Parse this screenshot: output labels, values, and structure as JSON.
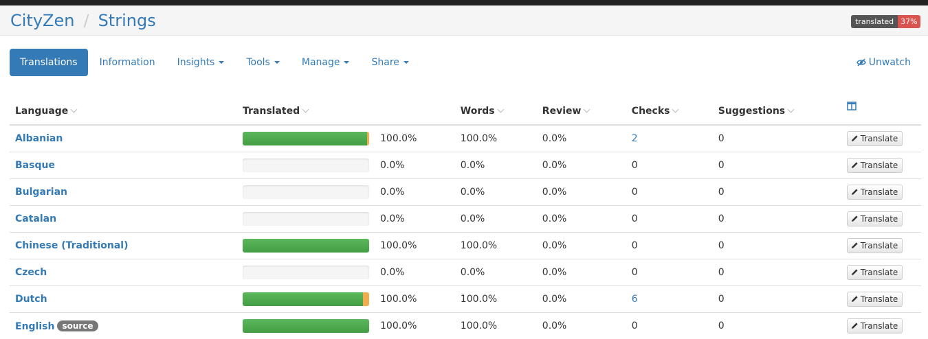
{
  "header": {
    "project": "CityZen",
    "separator": "/",
    "component": "Strings",
    "badge_label": "translated",
    "badge_value": "37%",
    "badge_color": "#d9534f"
  },
  "nav": {
    "tabs": [
      {
        "label": "Translations",
        "active": true,
        "dropdown": false
      },
      {
        "label": "Information",
        "active": false,
        "dropdown": false
      },
      {
        "label": "Insights",
        "active": false,
        "dropdown": true
      },
      {
        "label": "Tools",
        "active": false,
        "dropdown": true
      },
      {
        "label": "Manage",
        "active": false,
        "dropdown": true
      },
      {
        "label": "Share",
        "active": false,
        "dropdown": true
      }
    ],
    "unwatch_label": "Unwatch",
    "unwatch_icon": "eye-slash-icon"
  },
  "table": {
    "columns": {
      "language": "Language",
      "translated": "Translated",
      "words": "Words",
      "review": "Review",
      "checks": "Checks",
      "suggestions": "Suggestions"
    },
    "translate_label": "Translate",
    "columns_icon": "columns-icon",
    "rows": [
      {
        "language": "Albanian",
        "badge": "",
        "progress_ok": 0.985,
        "progress_warn": 0.015,
        "translated": "100.0%",
        "words": "100.0%",
        "review": "0.0%",
        "checks": "2",
        "checks_link": true,
        "suggestions": "0"
      },
      {
        "language": "Basque",
        "badge": "",
        "progress_ok": 0,
        "progress_warn": 0,
        "translated": "0.0%",
        "words": "0.0%",
        "review": "0.0%",
        "checks": "0",
        "checks_link": false,
        "suggestions": "0"
      },
      {
        "language": "Bulgarian",
        "badge": "",
        "progress_ok": 0,
        "progress_warn": 0,
        "translated": "0.0%",
        "words": "0.0%",
        "review": "0.0%",
        "checks": "0",
        "checks_link": false,
        "suggestions": "0"
      },
      {
        "language": "Catalan",
        "badge": "",
        "progress_ok": 0,
        "progress_warn": 0,
        "translated": "0.0%",
        "words": "0.0%",
        "review": "0.0%",
        "checks": "0",
        "checks_link": false,
        "suggestions": "0"
      },
      {
        "language": "Chinese (Traditional)",
        "badge": "",
        "progress_ok": 1.0,
        "progress_warn": 0,
        "translated": "100.0%",
        "words": "100.0%",
        "review": "0.0%",
        "checks": "0",
        "checks_link": false,
        "suggestions": "0"
      },
      {
        "language": "Czech",
        "badge": "",
        "progress_ok": 0,
        "progress_warn": 0,
        "translated": "0.0%",
        "words": "0.0%",
        "review": "0.0%",
        "checks": "0",
        "checks_link": false,
        "suggestions": "0"
      },
      {
        "language": "Dutch",
        "badge": "",
        "progress_ok": 0.95,
        "progress_warn": 0.05,
        "translated": "100.0%",
        "words": "100.0%",
        "review": "0.0%",
        "checks": "6",
        "checks_link": true,
        "suggestions": "0"
      },
      {
        "language": "English",
        "badge": "source",
        "progress_ok": 1.0,
        "progress_warn": 0,
        "translated": "100.0%",
        "words": "100.0%",
        "review": "0.0%",
        "checks": "0",
        "checks_link": false,
        "suggestions": "0"
      }
    ]
  }
}
